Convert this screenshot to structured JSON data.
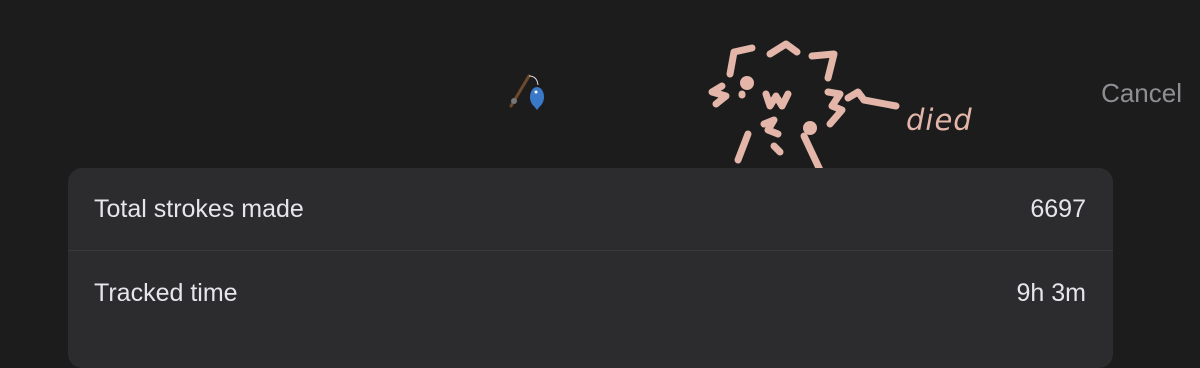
{
  "header": {
    "emoji_icon": "fishing-pole-with-blue-fish-icon",
    "doodle_text": "died",
    "doodle_color": "#e3b6a9",
    "cancel_label": "Cancel"
  },
  "stats": {
    "rows": [
      {
        "label": "Total strokes made",
        "value": "6697"
      },
      {
        "label": "Tracked time",
        "value": "9h 3m"
      }
    ]
  },
  "colors": {
    "background": "#1c1c1d",
    "panel": "#2c2c2e",
    "text": "#e5e5ea",
    "secondary_text": "#8e8e93"
  }
}
